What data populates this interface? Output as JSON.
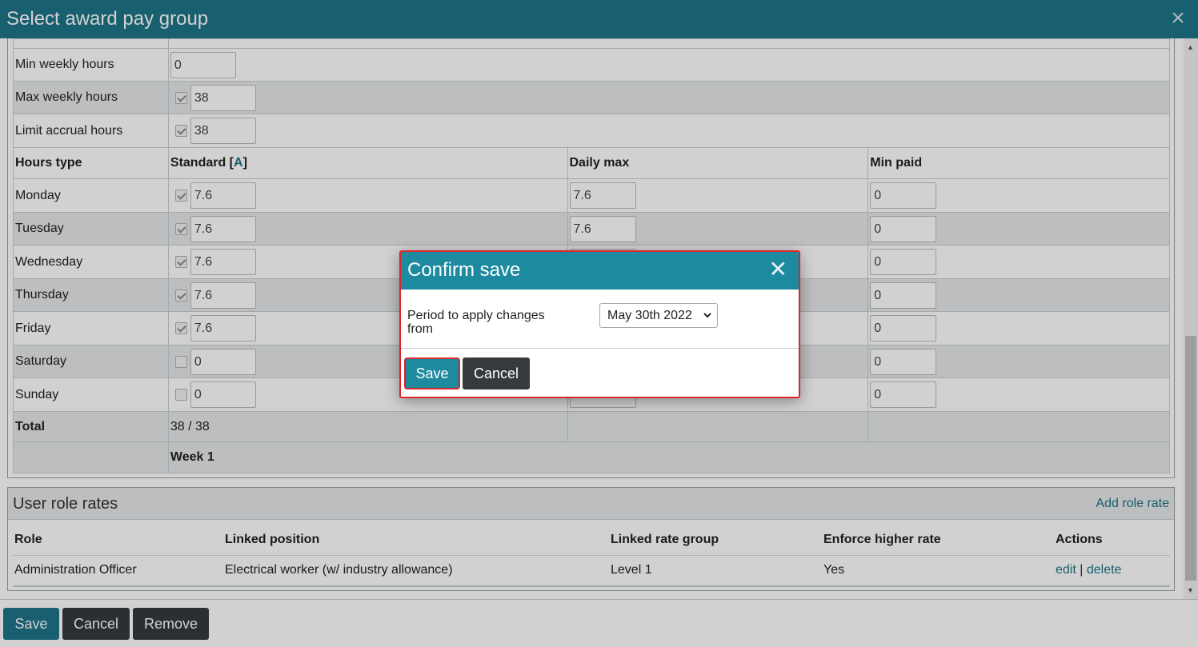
{
  "window": {
    "title": "Select award pay group",
    "close_icon": "×"
  },
  "limits": [
    {
      "label": "Min weekly hours",
      "value": "0",
      "has_checkbox": false
    },
    {
      "label": "Max weekly hours",
      "value": "38",
      "has_checkbox": true,
      "checked": true
    },
    {
      "label": "Limit accrual hours",
      "value": "38",
      "has_checkbox": true,
      "checked": true
    }
  ],
  "hours_table": {
    "headers": {
      "hours_type": "Hours type",
      "standard": "Standard [",
      "standard_link": "A",
      "standard_close": "]",
      "daily_max": "Daily max",
      "min_paid": "Min paid"
    },
    "days": [
      {
        "name": "Monday",
        "checked": true,
        "standard": "7.6",
        "daily_max": "7.6",
        "min_paid": "0"
      },
      {
        "name": "Tuesday",
        "checked": true,
        "standard": "7.6",
        "daily_max": "7.6",
        "min_paid": "0"
      },
      {
        "name": "Wednesday",
        "checked": true,
        "standard": "7.6",
        "daily_max": "",
        "min_paid": "0"
      },
      {
        "name": "Thursday",
        "checked": true,
        "standard": "7.6",
        "daily_max": "",
        "min_paid": "0"
      },
      {
        "name": "Friday",
        "checked": true,
        "standard": "7.6",
        "daily_max": "",
        "min_paid": "0"
      },
      {
        "name": "Saturday",
        "checked": false,
        "standard": "0",
        "daily_max": "",
        "min_paid": "0"
      },
      {
        "name": "Sunday",
        "checked": false,
        "standard": "0",
        "daily_max": "",
        "min_paid": "0"
      }
    ],
    "total_label": "Total",
    "total_value": "38 / 38",
    "week_label": "Week 1"
  },
  "user_role_rates": {
    "title": "User role rates",
    "add_link": "Add role rate",
    "headers": {
      "role": "Role",
      "linked_position": "Linked position",
      "linked_rate_group": "Linked rate group",
      "enforce_higher_rate": "Enforce higher rate",
      "actions": "Actions"
    },
    "rows": [
      {
        "role": "Administration Officer",
        "linked_position": "Electrical worker (w/ industry allowance)",
        "linked_rate_group": "Level 1",
        "enforce_higher_rate": "Yes",
        "edit": "edit",
        "sep": "|",
        "delete": "delete"
      }
    ]
  },
  "footer": {
    "save": "Save",
    "cancel": "Cancel",
    "remove": "Remove"
  },
  "modal": {
    "title": "Confirm save",
    "close_icon": "✕",
    "period_label": "Period to apply changes from",
    "period_value": "May 30th 2022",
    "save": "Save",
    "cancel": "Cancel"
  },
  "colors": {
    "header": "#1e7488",
    "modal_header": "#1e8aa0",
    "dark_button": "#343a3d",
    "highlight_border": "#d9262b",
    "link": "#1e7488"
  }
}
